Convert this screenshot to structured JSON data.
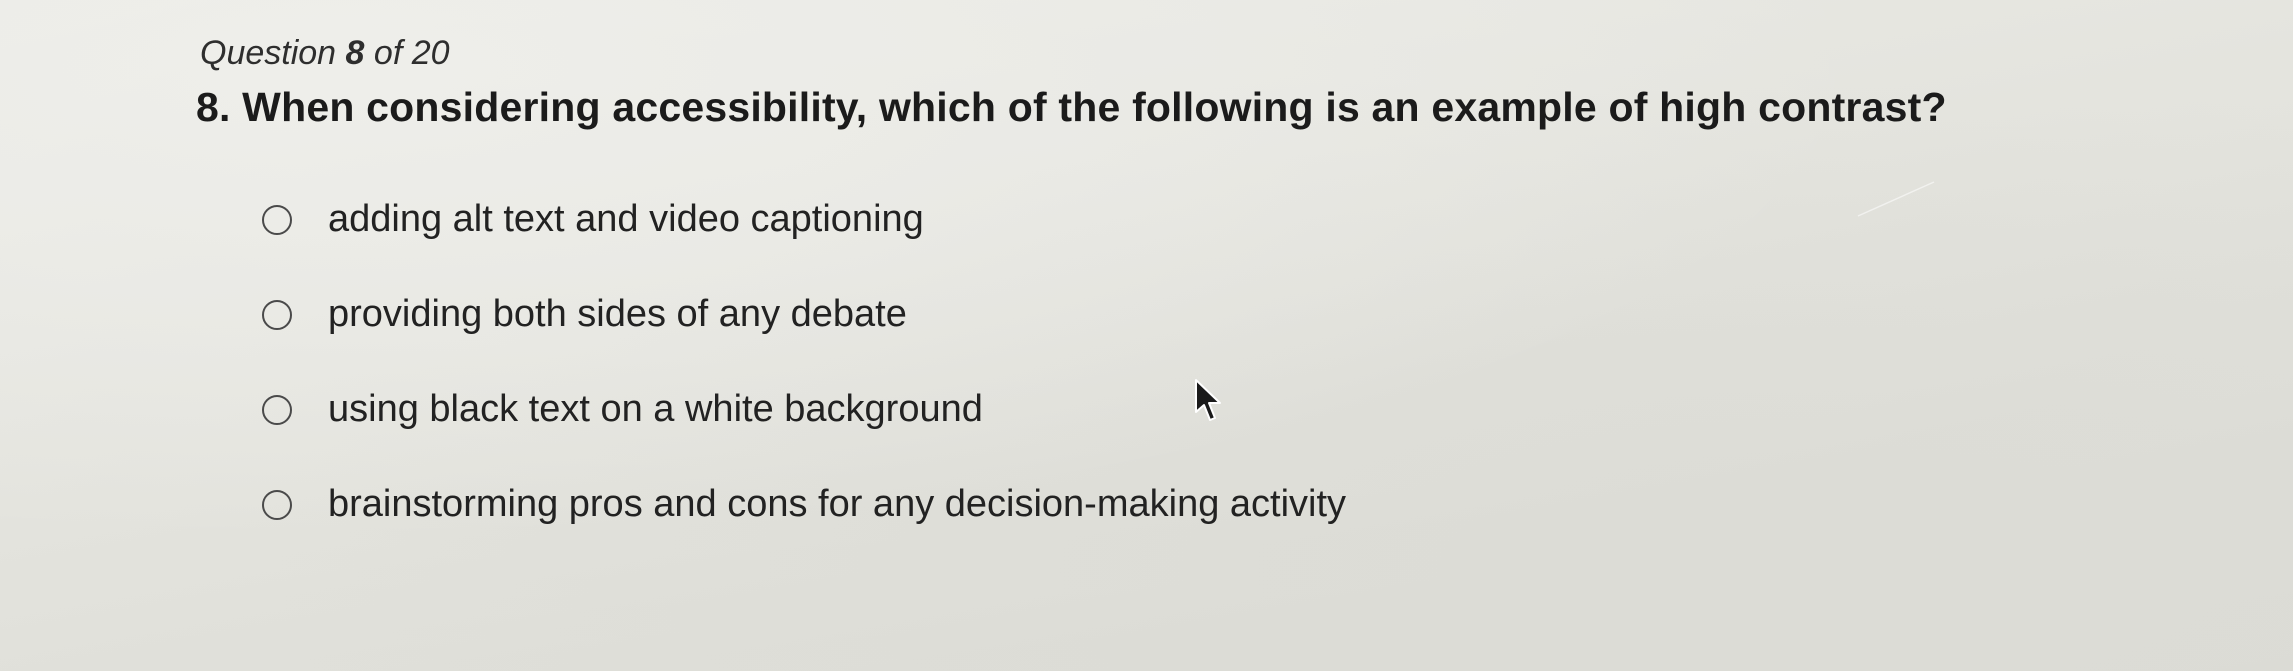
{
  "question": {
    "counter_prefix": "Question",
    "counter_number": "8",
    "counter_of": "of",
    "counter_total": "20",
    "text": "8. When considering accessibility, which of the following is an example of high contrast?"
  },
  "options": [
    {
      "label": "adding alt text and video captioning",
      "selected": false
    },
    {
      "label": "providing both sides of any debate",
      "selected": false
    },
    {
      "label": "using black text on a white background",
      "selected": false
    },
    {
      "label": "brainstorming pros and cons for any decision-making activity",
      "selected": false
    }
  ],
  "icons": {
    "radio": "radio-button-icon",
    "cursor": "mouse-pointer-icon"
  },
  "colors": {
    "text": "#1b1b1b",
    "radio_border": "#4a4a4a"
  }
}
